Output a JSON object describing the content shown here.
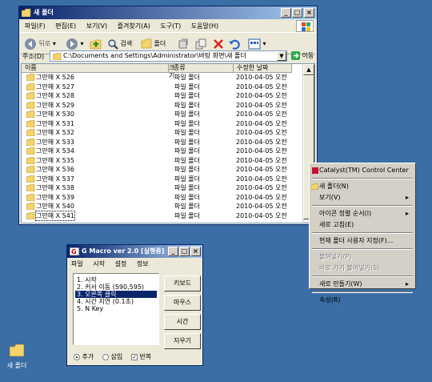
{
  "explorer": {
    "title": "새 폴더",
    "menu": [
      "파일(F)",
      "편집(E)",
      "보기(V)",
      "즐겨찾기(A)",
      "도구(T)",
      "도움말(H)"
    ],
    "toolbar": {
      "back": "뒤로",
      "search": "검색",
      "folders": "폴더"
    },
    "address_label": "주소(D)",
    "address_value": "C:\\Documents and Settings\\Administrator\\바탕 화면\\새 폴더",
    "go_label": "이동",
    "columns": [
      "이름",
      "크기",
      "종류",
      "수정한 날짜"
    ],
    "rows": [
      {
        "name": "그만해 X 526",
        "type": "파일 폴더",
        "date": "2010-04-05 오전"
      },
      {
        "name": "그만해 X 527",
        "type": "파일 폴더",
        "date": "2010-04-05 오전"
      },
      {
        "name": "그만해 X 528",
        "type": "파일 폴더",
        "date": "2010-04-05 오전"
      },
      {
        "name": "그만해 X 529",
        "type": "파일 폴더",
        "date": "2010-04-05 오전"
      },
      {
        "name": "그만해 X 530",
        "type": "파일 폴더",
        "date": "2010-04-05 오전"
      },
      {
        "name": "그만해 X 531",
        "type": "파일 폴더",
        "date": "2010-04-05 오전"
      },
      {
        "name": "그만해 X 532",
        "type": "파일 폴더",
        "date": "2010-04-05 오전"
      },
      {
        "name": "그만해 X 533",
        "type": "파일 폴더",
        "date": "2010-04-05 오전"
      },
      {
        "name": "그만해 X 534",
        "type": "파일 폴더",
        "date": "2010-04-05 오전"
      },
      {
        "name": "그만해 X 535",
        "type": "파일 폴더",
        "date": "2010-04-05 오전"
      },
      {
        "name": "그만해 X 536",
        "type": "파일 폴더",
        "date": "2010-04-05 오전"
      },
      {
        "name": "그만해 X 537",
        "type": "파일 폴더",
        "date": "2010-04-05 오전"
      },
      {
        "name": "그만해 X 538",
        "type": "파일 폴더",
        "date": "2010-04-05 오전"
      },
      {
        "name": "그만해 X 539",
        "type": "파일 폴더",
        "date": "2010-04-05 오전"
      },
      {
        "name": "그만해 X 540",
        "type": "파일 폴더",
        "date": "2010-04-05 오전"
      },
      {
        "name": "그만해 X 541",
        "type": "파일 폴더",
        "date": "2010-04-05 오전"
      }
    ]
  },
  "context_menu": {
    "items": [
      {
        "label": "Catalyst(TM) Control Center",
        "submenu": false,
        "disabled": false,
        "icon": "ati-icon"
      },
      {
        "sep": true
      },
      {
        "label": "새 폴더(N)",
        "submenu": false,
        "disabled": false,
        "icon": "new-folder-icon"
      },
      {
        "label": "보기(V)",
        "submenu": true,
        "disabled": false
      },
      {
        "sep": true
      },
      {
        "label": "아이콘 정렬 순서(I)",
        "submenu": true,
        "disabled": false
      },
      {
        "label": "새로 고침(E)",
        "submenu": false,
        "disabled": false
      },
      {
        "sep": true
      },
      {
        "label": "현재 폴더 사용자 지정(F)...",
        "submenu": false,
        "disabled": false
      },
      {
        "sep": true
      },
      {
        "label": "붙여넣기(P)",
        "submenu": false,
        "disabled": true
      },
      {
        "label": "바로 가기 붙여넣기(S)",
        "submenu": false,
        "disabled": true
      },
      {
        "sep": true
      },
      {
        "label": "새로 만들기(W)",
        "submenu": true,
        "disabled": false
      },
      {
        "sep": true
      },
      {
        "label": "속성(R)",
        "submenu": false,
        "disabled": false
      }
    ]
  },
  "macro": {
    "title": "G Macro  ver 2.0  [실행중]",
    "menu": [
      "파일",
      "시작",
      "설정",
      "정보"
    ],
    "steps": [
      "1. 시작",
      "2. 커서 이동 (590,595)",
      "3. 오른쪽 클릭",
      "4. 시간 지연 (0.1초)",
      "5. N Key"
    ],
    "selected_index": 2,
    "buttons": [
      "키보드",
      "마우스",
      "시간",
      "지우기"
    ],
    "radio_add": "추가",
    "radio_insert": "삽입",
    "repeat_label": "반복"
  },
  "desktop": {
    "icon_label": "새 폴더"
  },
  "colors": {
    "desktop": "#3a6ea5",
    "title_start": "#0a246a",
    "title_end": "#a6caf0",
    "highlight": "#0a246a",
    "folder": "#f4d36a"
  }
}
